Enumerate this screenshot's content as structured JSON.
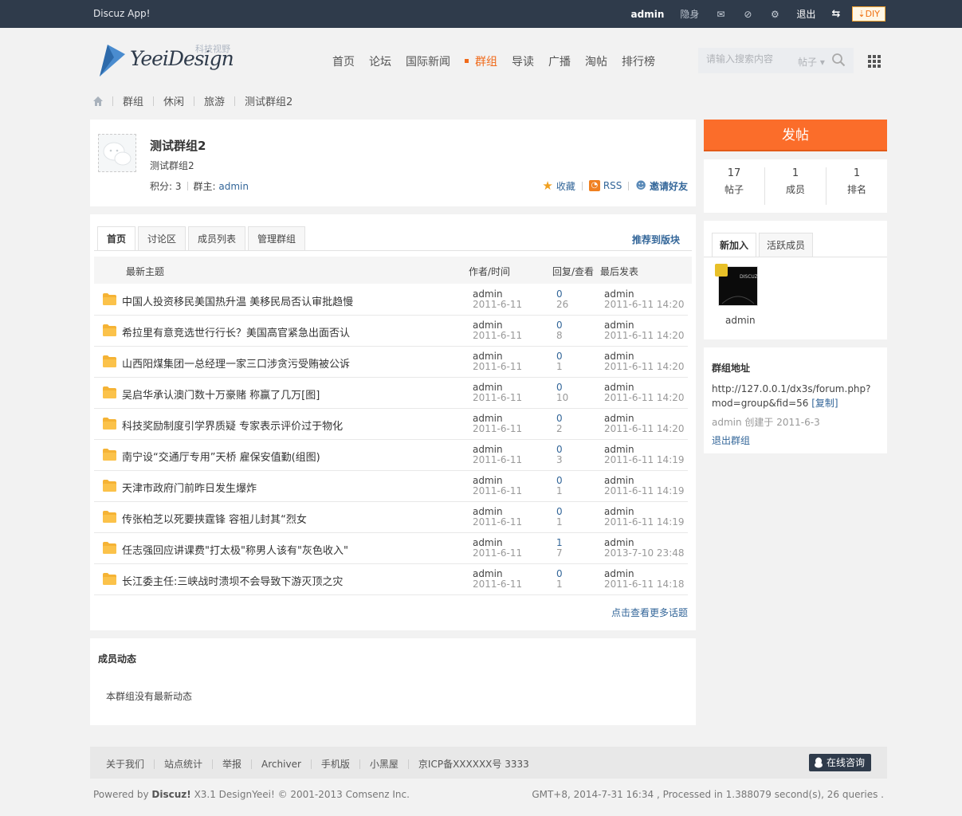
{
  "topbar": {
    "app_name": "Discuz App!",
    "username": "admin",
    "invisible": "隐身",
    "logout": "退出",
    "diy": "DIY",
    "icons": [
      "mail-icon",
      "notification-icon",
      "settings-icon",
      "switch-icon"
    ]
  },
  "header": {
    "logo_word": "YeeiDesign",
    "logo_tagline": "科技视野",
    "nav": [
      "首页",
      "论坛",
      "国际新闻",
      "群组",
      "导读",
      "广播",
      "淘帖",
      "排行榜"
    ],
    "active_nav": "群组",
    "search_placeholder": "请输入搜索内容",
    "search_type": "帖子"
  },
  "breadcrumb": [
    "群组",
    "休闲",
    "旅游",
    "测试群组2"
  ],
  "group": {
    "title": "测试群组2",
    "description": "测试群组2",
    "points_label": "积分: 3",
    "owner_label": "群主:",
    "owner": "admin",
    "favorite": "收藏",
    "rss": "RSS",
    "invite": "邀请好友"
  },
  "threads": {
    "tabs": [
      "首页",
      "讨论区",
      "成员列表",
      "管理群组"
    ],
    "recommend": "推荐到版块",
    "columns": {
      "title": "最新主题",
      "author": "作者/时间",
      "replies": "回复/查看",
      "last": "最后发表"
    },
    "rows": [
      {
        "title": "中国人投资移民美国热升温 美移民局否认审批趋慢",
        "author": "admin",
        "date": "2011-6-11",
        "replies": "0",
        "views": "26",
        "last_user": "admin",
        "last_time": "2011-6-11 14:20"
      },
      {
        "title": "希拉里有意竞选世行行长？美国高官紧急出面否认",
        "author": "admin",
        "date": "2011-6-11",
        "replies": "0",
        "views": "8",
        "last_user": "admin",
        "last_time": "2011-6-11 14:20"
      },
      {
        "title": "山西阳煤集团一总经理一家三口涉贪污受贿被公诉",
        "author": "admin",
        "date": "2011-6-11",
        "replies": "0",
        "views": "1",
        "last_user": "admin",
        "last_time": "2011-6-11 14:20"
      },
      {
        "title": "吴启华承认澳门数十万豪赌 称赢了几万[图]",
        "author": "admin",
        "date": "2011-6-11",
        "replies": "0",
        "views": "10",
        "last_user": "admin",
        "last_time": "2011-6-11 14:20"
      },
      {
        "title": "科技奖励制度引学界质疑 专家表示评价过于物化",
        "author": "admin",
        "date": "2011-6-11",
        "replies": "0",
        "views": "2",
        "last_user": "admin",
        "last_time": "2011-6-11 14:20"
      },
      {
        "title": "南宁设“交通厅专用”天桥 雇保安值勤(组图)",
        "author": "admin",
        "date": "2011-6-11",
        "replies": "0",
        "views": "3",
        "last_user": "admin",
        "last_time": "2011-6-11 14:19"
      },
      {
        "title": "天津市政府门前昨日发生爆炸",
        "author": "admin",
        "date": "2011-6-11",
        "replies": "0",
        "views": "1",
        "last_user": "admin",
        "last_time": "2011-6-11 14:19"
      },
      {
        "title": "传张柏芝以死要挟霆锋 容祖儿封其“烈女",
        "author": "admin",
        "date": "2011-6-11",
        "replies": "0",
        "views": "1",
        "last_user": "admin",
        "last_time": "2011-6-11 14:19"
      },
      {
        "title": "任志强回应讲课费\"打太极\"称男人该有\"灰色收入\"",
        "author": "admin",
        "date": "2011-6-11",
        "replies": "1",
        "views": "7",
        "last_user": "admin",
        "last_time": "2013-7-10 23:48"
      },
      {
        "title": "长江委主任:三峡战时溃坝不会导致下游灭顶之灾",
        "author": "admin",
        "date": "2011-6-11",
        "replies": "0",
        "views": "1",
        "last_user": "admin",
        "last_time": "2011-6-11 14:18"
      }
    ],
    "more": "点击查看更多话题"
  },
  "activity": {
    "heading": "成员动态",
    "empty": "本群组没有最新动态"
  },
  "sidebar": {
    "post_button": "发帖",
    "stats": [
      {
        "num": "17",
        "label": "帖子"
      },
      {
        "num": "1",
        "label": "成员"
      },
      {
        "num": "1",
        "label": "排名"
      }
    ],
    "member_tabs": [
      "新加入",
      "活跃成员"
    ],
    "member_name": "admin",
    "address_heading": "群组地址",
    "address_url": "http://127.0.0.1/dx3s/forum.php?mod=group&fid=56",
    "copy": "[复制]",
    "created": "admin 创建于 2011-6-3",
    "leave": "退出群组"
  },
  "footer": {
    "links": [
      "关于我们",
      "站点统计",
      "举报",
      "Archiver",
      "手机版",
      "小黑屋",
      "京ICP备XXXXXX号 3333"
    ],
    "chat": "在线咨询",
    "powered_prefix": "Powered by",
    "powered_brand": "Discuz!",
    "powered_suffix": "X3.1 DesignYeei! © 2001-2013 Comsenz Inc.",
    "server_info": "GMT+8, 2014-7-31 16:34 , Processed in 1.388079 second(s), 26 queries ."
  },
  "colors": {
    "topbar": "#2f3b4b",
    "accent": "#fb6d2a",
    "link": "#336699"
  }
}
